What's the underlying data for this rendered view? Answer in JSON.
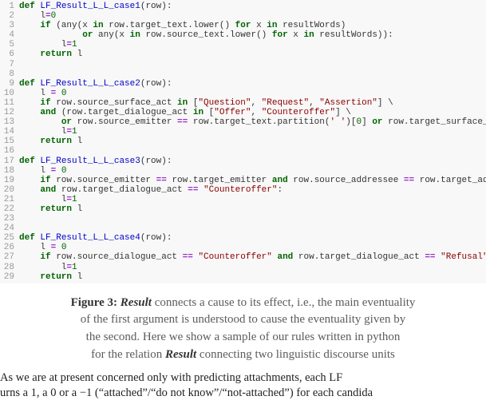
{
  "code": {
    "lines": [
      {
        "n": "1",
        "html": "<span class='kw'>def</span> <span class='fn'>LF_Result_L_L_case1</span>(row):"
      },
      {
        "n": "2",
        "html": "    l<span class='op'>=</span><span class='num'>0</span>"
      },
      {
        "n": "3",
        "html": "    <span class='kw'>if</span> (any(x <span class='ctl'>in</span> row.target_text.lower() <span class='kw'>for</span> x <span class='ctl'>in</span> resultWords)"
      },
      {
        "n": "4",
        "html": "            <span class='ctl'>or</span> any(x <span class='ctl'>in</span> row.source_text.lower() <span class='kw'>for</span> x <span class='ctl'>in</span> resultWords)):"
      },
      {
        "n": "5",
        "html": "        l<span class='op'>=</span><span class='num'>1</span>"
      },
      {
        "n": "6",
        "html": "    <span class='ctl'>return</span> l"
      },
      {
        "n": "7",
        "html": ""
      },
      {
        "n": "8",
        "html": ""
      },
      {
        "n": "9",
        "html": "<span class='kw'>def</span> <span class='fn'>LF_Result_L_L_case2</span>(row):"
      },
      {
        "n": "10",
        "html": "    l <span class='op'>=</span> <span class='num'>0</span>"
      },
      {
        "n": "11",
        "html": "    <span class='kw'>if</span> row.source_surface_act <span class='ctl'>in</span> [<span class='str'>\"Question\"</span>, <span class='str'>\"Request\"</span>, <span class='str'>\"Assertion\"</span>] \\"
      },
      {
        "n": "12",
        "html": "    <span class='ctl'>and</span> (row.target_dialogue_act <span class='ctl'>in</span> [<span class='str'>\"Offer\"</span>, <span class='str'>\"Counteroffer\"</span>] \\"
      },
      {
        "n": "13",
        "html": "        <span class='ctl'>or</span> row.source_emitter <span class='op'>==</span> row.target_text.partition(<span class='str'>' '</span>)[<span class='num'>0</span>] <span class='ctl'>or</span> row.target_surface_act <span class='op'>==</span> <span class='str'>\"Request\"</span>"
      },
      {
        "n": "14",
        "html": "        l<span class='op'>=</span><span class='num'>1</span>"
      },
      {
        "n": "15",
        "html": "    <span class='ctl'>return</span> l"
      },
      {
        "n": "16",
        "html": ""
      },
      {
        "n": "17",
        "html": "<span class='kw'>def</span> <span class='fn'>LF_Result_L_L_case3</span>(row):"
      },
      {
        "n": "18",
        "html": "    l <span class='op'>=</span> <span class='num'>0</span>"
      },
      {
        "n": "19",
        "html": "    <span class='kw'>if</span> row.source_emitter <span class='op'>==</span> row.target_emitter <span class='ctl'>and</span> row.source_addressee <span class='op'>==</span> row.target_addressee \\"
      },
      {
        "n": "20",
        "html": "    <span class='ctl'>and</span> row.target_dialogue_act <span class='op'>==</span> <span class='str'>\"Counteroffer\"</span>:"
      },
      {
        "n": "21",
        "html": "        l<span class='op'>=</span><span class='num'>1</span>"
      },
      {
        "n": "22",
        "html": "    <span class='ctl'>return</span> l"
      },
      {
        "n": "23",
        "html": ""
      },
      {
        "n": "24",
        "html": ""
      },
      {
        "n": "25",
        "html": "<span class='kw'>def</span> <span class='fn'>LF_Result_L_L_case4</span>(row):"
      },
      {
        "n": "26",
        "html": "    l <span class='op'>=</span> <span class='num'>0</span>"
      },
      {
        "n": "27",
        "html": "    <span class='kw'>if</span> row.source_dialogue_act <span class='op'>==</span> <span class='str'>\"Counteroffer\"</span> <span class='ctl'>and</span> row.target_dialogue_act <span class='op'>==</span> <span class='str'>\"Refusal\"</span>:"
      },
      {
        "n": "28",
        "html": "        l<span class='op'>=</span><span class='num'>1</span>"
      },
      {
        "n": "29",
        "html": "    <span class='ctl'>return</span> l"
      }
    ]
  },
  "caption": {
    "label": "Figure 3:",
    "term": "Result",
    "sentence1_part1": " connects a cause to its effect, i.e., the main eventuality",
    "sentence2": "of the first argument is understood to cause the eventuality given by",
    "sentence3": "the second. Here we show a sample of our rules written in python",
    "sentence4_pre": "for the relation ",
    "sentence4_post": " connecting two linguistic discourse units"
  },
  "body": {
    "line1": "    As we are at present concerned only with predicting attachments, each LF ",
    "line2": "urns a 1, a 0 or a −1 (“attached”/“do not know”/“not-attached”) for each candida"
  }
}
